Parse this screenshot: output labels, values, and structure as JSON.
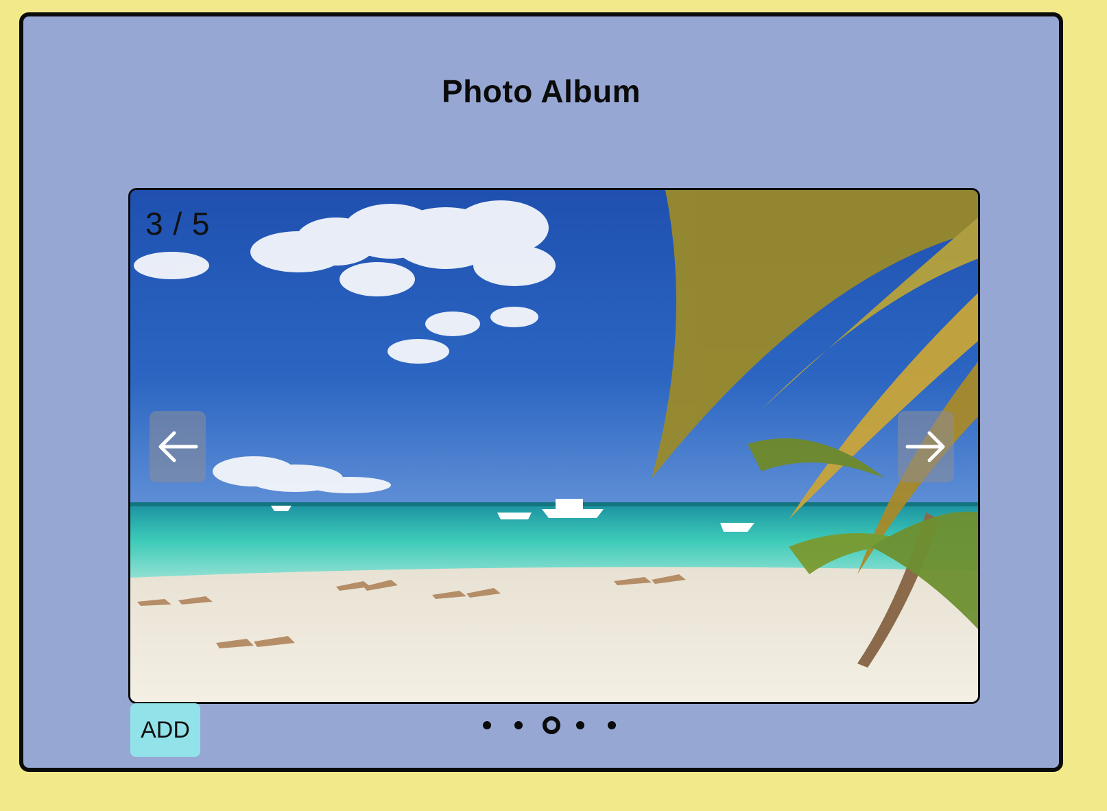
{
  "app": {
    "title": "Photo Album"
  },
  "viewer": {
    "counter": "3 / 5",
    "current_index": 3,
    "total": 5,
    "photo_subject": "tropical beach with palm trees, boats and sun loungers",
    "prev_icon": "arrow-left-icon",
    "next_icon": "arrow-right-icon"
  },
  "controls": {
    "add_label": "ADD"
  },
  "pagination": {
    "dots": [
      {
        "index": 1,
        "active": false
      },
      {
        "index": 2,
        "active": false
      },
      {
        "index": 3,
        "active": true
      },
      {
        "index": 4,
        "active": false
      },
      {
        "index": 5,
        "active": false
      }
    ]
  },
  "colors": {
    "page_background": "#f2e98a",
    "window_background": "#97a7d4",
    "add_button": "#92e3e9",
    "border": "#0b0b0b"
  }
}
